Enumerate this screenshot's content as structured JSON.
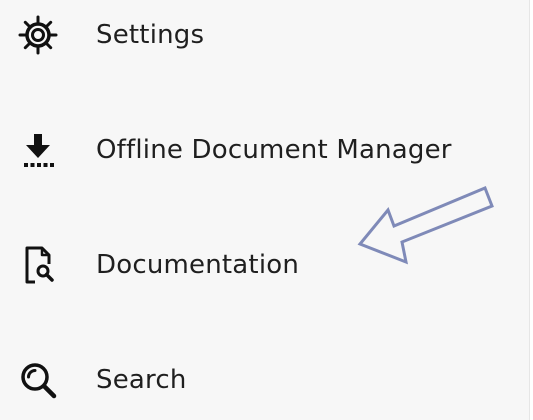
{
  "menu": {
    "items": [
      {
        "label": "Settings",
        "icon": "gear-icon"
      },
      {
        "label": "Offline Document Manager",
        "icon": "download-icon"
      },
      {
        "label": "Documentation",
        "icon": "document-search-icon"
      },
      {
        "label": "Search",
        "icon": "search-icon"
      }
    ]
  },
  "annotation": {
    "arrow_icon": "arrow-left-icon",
    "arrow_color": "#7f8ab8"
  },
  "colors": {
    "background": "#f7f7f7",
    "text": "#1f1f1f",
    "icon": "#111111"
  }
}
